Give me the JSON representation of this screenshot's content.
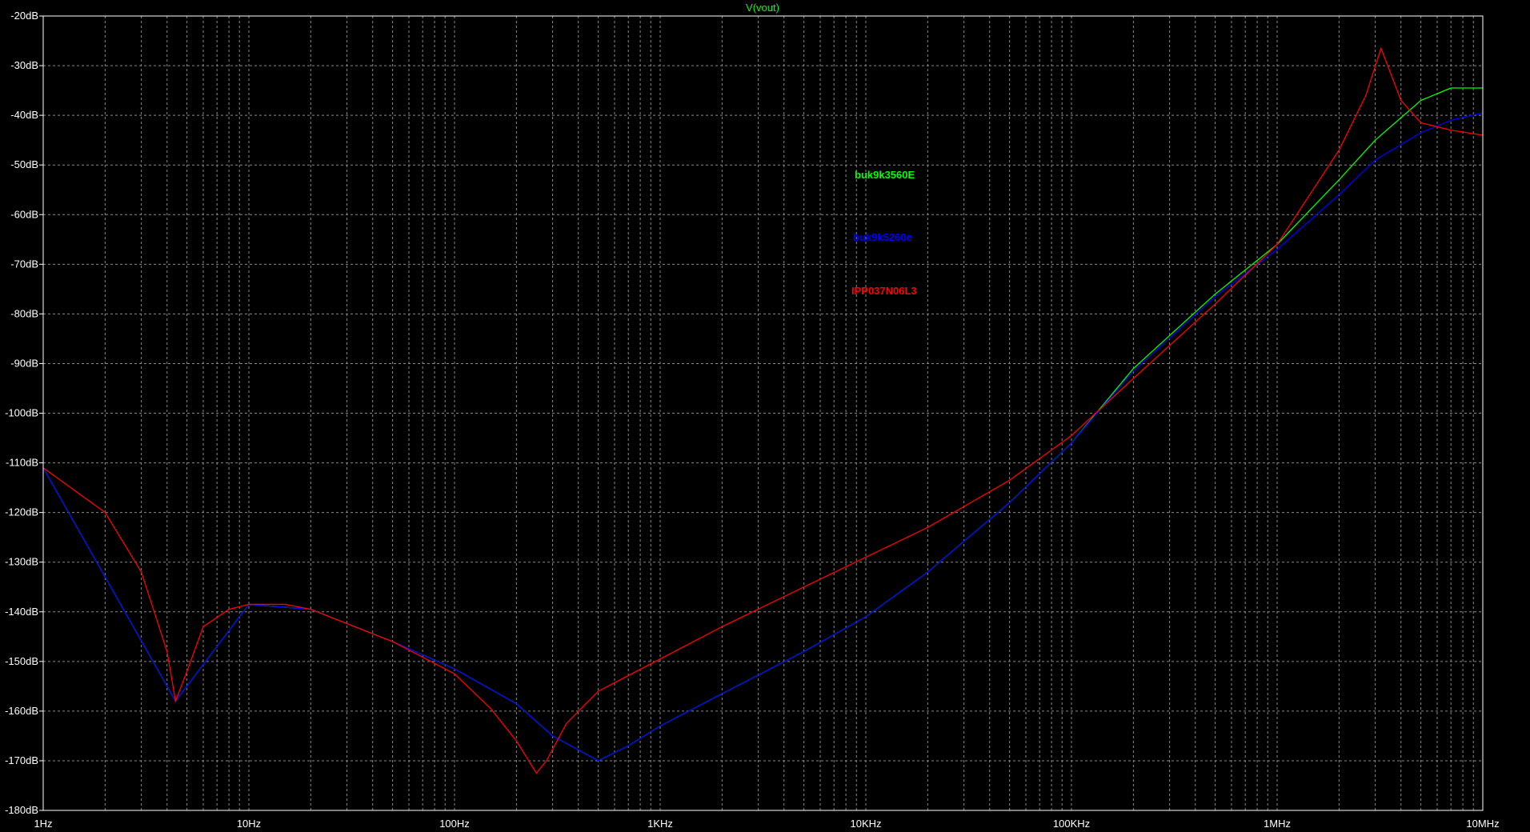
{
  "chart_data": {
    "type": "line",
    "title": "V(vout)",
    "xlabel": "",
    "ylabel": "",
    "x_scale": "log",
    "xlim": [
      1,
      10000000
    ],
    "ylim": [
      -180,
      -20
    ],
    "grid": true,
    "legend_placement": "center",
    "x_ticks": [
      {
        "value": 1,
        "label": "1Hz"
      },
      {
        "value": 10,
        "label": "10Hz"
      },
      {
        "value": 100,
        "label": "100Hz"
      },
      {
        "value": 1000,
        "label": "1KHz"
      },
      {
        "value": 10000,
        "label": "10KHz"
      },
      {
        "value": 100000,
        "label": "100KHz"
      },
      {
        "value": 1000000,
        "label": "1MHz"
      },
      {
        "value": 10000000,
        "label": "10MHz"
      }
    ],
    "y_ticks": [
      {
        "value": -20,
        "label": "-20dB"
      },
      {
        "value": -30,
        "label": "-30dB"
      },
      {
        "value": -40,
        "label": "-40dB"
      },
      {
        "value": -50,
        "label": "-50dB"
      },
      {
        "value": -60,
        "label": "-60dB"
      },
      {
        "value": -70,
        "label": "-70dB"
      },
      {
        "value": -80,
        "label": "-80dB"
      },
      {
        "value": -90,
        "label": "-90dB"
      },
      {
        "value": -100,
        "label": "-100dB"
      },
      {
        "value": -110,
        "label": "-110dB"
      },
      {
        "value": -120,
        "label": "-120dB"
      },
      {
        "value": -130,
        "label": "-130dB"
      },
      {
        "value": -140,
        "label": "-140dB"
      },
      {
        "value": -150,
        "label": "-150dB"
      },
      {
        "value": -160,
        "label": "-160dB"
      },
      {
        "value": -170,
        "label": "-170dB"
      },
      {
        "value": -180,
        "label": "-180dB"
      }
    ],
    "series": [
      {
        "name": "buk9k3560E",
        "color": "#00ff00",
        "x": [
          1,
          4.4,
          10,
          20,
          50,
          100,
          200,
          300,
          500,
          700,
          1000,
          2000,
          5000,
          10000,
          20000,
          50000,
          100000,
          200000,
          500000,
          1000000,
          2000000,
          3000000,
          5000000,
          7000000,
          10000000
        ],
        "y": [
          -111,
          -158,
          -138.5,
          -139.5,
          -146,
          -151.5,
          -158.5,
          -165,
          -170,
          -167,
          -163,
          -156.5,
          -148,
          -141,
          -132,
          -118,
          -106,
          -91,
          -76,
          -66,
          -53,
          -45,
          -37,
          -34.5,
          -34.5
        ]
      },
      {
        "name": "buk9k5260e",
        "color": "#0000ff",
        "x": [
          1,
          4.4,
          10,
          20,
          50,
          100,
          200,
          300,
          500,
          700,
          1000,
          2000,
          5000,
          10000,
          20000,
          50000,
          100000,
          200000,
          500000,
          1000000,
          2000000,
          3000000,
          5000000,
          7000000,
          10000000
        ],
        "y": [
          -111,
          -158,
          -138.5,
          -139.5,
          -146,
          -151.5,
          -158.5,
          -165,
          -170,
          -167,
          -163,
          -156.5,
          -148,
          -141,
          -132,
          -118,
          -106,
          -91.5,
          -76.5,
          -67,
          -56,
          -49,
          -43.5,
          -41,
          -39.5
        ]
      },
      {
        "name": "IPP037N06L3",
        "color": "#ff0000",
        "x": [
          1,
          2,
          3,
          4,
          4.4,
          5,
          6,
          8,
          10,
          15,
          20,
          50,
          100,
          150,
          200,
          250,
          280,
          350,
          500,
          1000,
          2000,
          5000,
          10000,
          20000,
          50000,
          100000,
          200000,
          500000,
          1000000,
          2000000,
          2700000,
          3200000,
          4000000,
          5000000,
          7000000,
          10000000
        ],
        "y": [
          -111,
          -120,
          -132,
          -148,
          -158,
          -152,
          -143,
          -139.5,
          -138.5,
          -138.5,
          -139.5,
          -146,
          -152.5,
          -159.5,
          -166,
          -172.5,
          -170,
          -162.5,
          -156,
          -149.5,
          -143,
          -135,
          -129,
          -123,
          -113.5,
          -104.5,
          -93,
          -78,
          -66,
          -47,
          -36,
          -26.5,
          -37,
          -41.5,
          -43,
          -44
        ]
      }
    ]
  }
}
